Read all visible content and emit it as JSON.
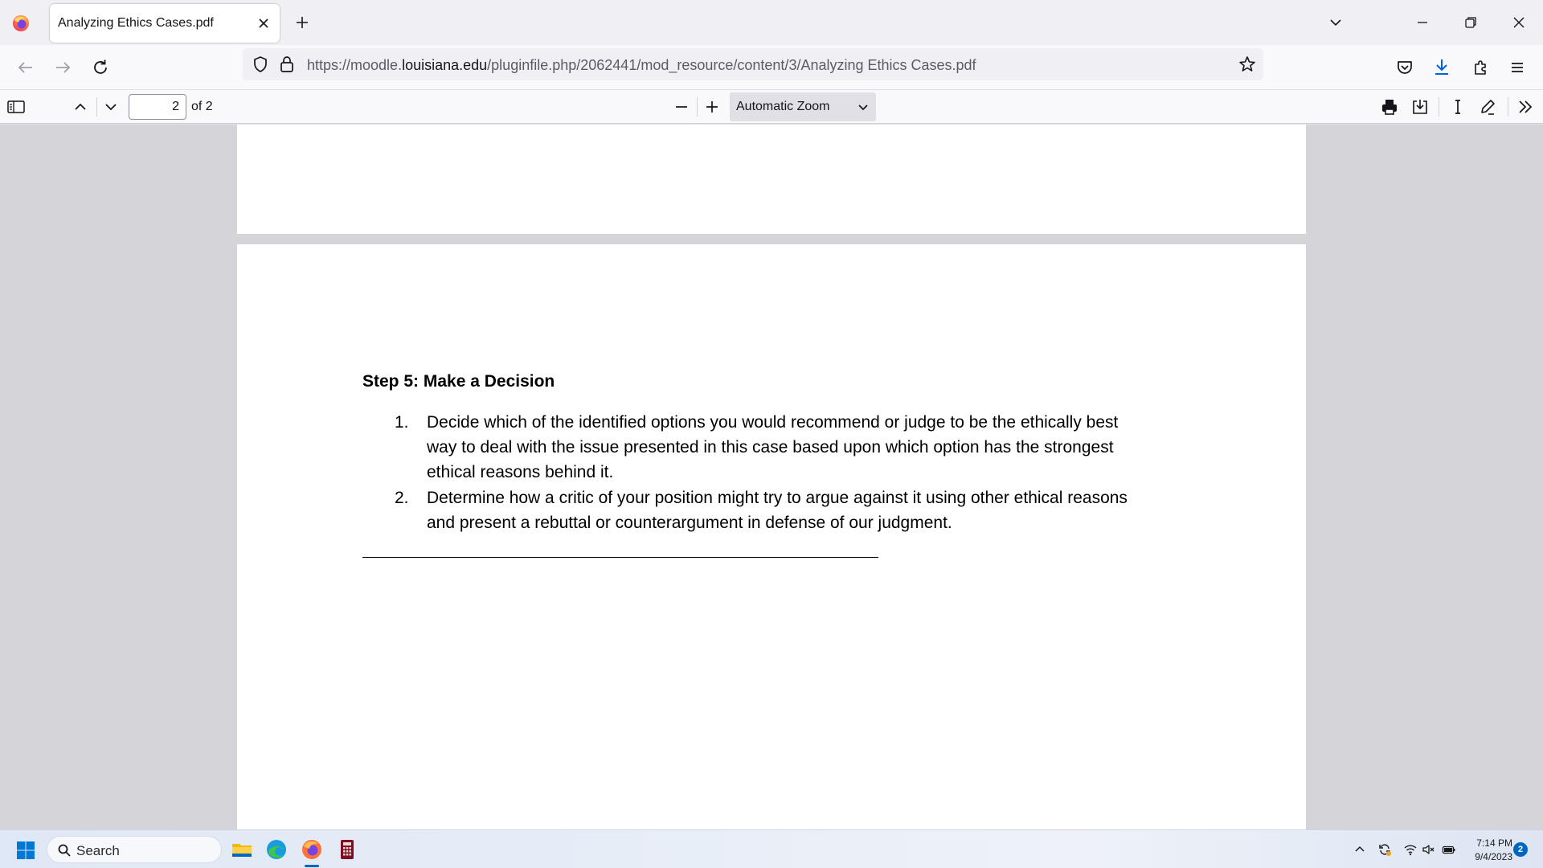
{
  "browser": {
    "tab": {
      "title": "Analyzing Ethics Cases.pdf"
    },
    "url": {
      "prefix": "https://moodle.",
      "host": "louisiana.edu",
      "path": "/pluginfile.php/2062441/mod_resource/content/3/Analyzing Ethics Cases.pdf"
    }
  },
  "pdf_toolbar": {
    "page_number": "2",
    "page_count_label": "of 2",
    "zoom_label": "Automatic Zoom"
  },
  "document": {
    "heading": "Step 5: Make a Decision",
    "items": [
      {
        "number": "1.",
        "lines": [
          "Decide which of the identified options you would recommend or judge to be the ethically best",
          "way to deal with the issue presented in this case based upon which option has the strongest",
          "ethical reasons behind it."
        ]
      },
      {
        "number": "2.",
        "lines": [
          "Determine how a critic of your position might try to argue against it using other ethical reasons",
          "and present a rebuttal or counterargument in defense of our judgment."
        ]
      }
    ]
  },
  "taskbar": {
    "search_label": "Search",
    "time": "7:14 PM",
    "date": "9/4/2023",
    "notification_count": "2"
  },
  "colors": {
    "accent": "#0061e0",
    "firefox_orange": "#ff7139",
    "firefox_purple": "#7542e5",
    "viewer_bg": "#d4d4d9"
  }
}
